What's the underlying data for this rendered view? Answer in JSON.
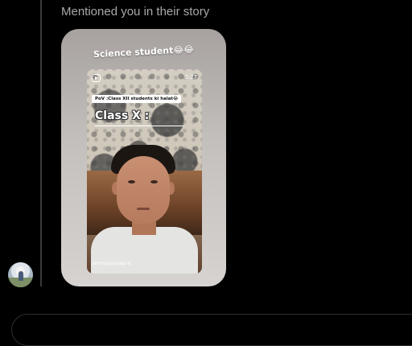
{
  "message": {
    "mention_text": "Mentioned you in their story"
  },
  "story": {
    "caption": "Science student😂😂",
    "reel": {
      "duration": "0:27",
      "pov_text": "PoV :Class XII students ki halat😂",
      "overlay_text": "Class X :",
      "username": "janmayjaysapra",
      "icon": "reel-icon"
    }
  },
  "avatar": {
    "icon": "avatar"
  }
}
